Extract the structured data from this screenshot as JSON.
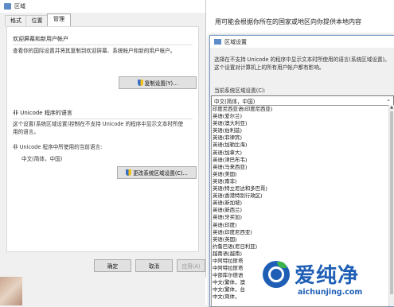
{
  "region_window": {
    "title": "区域",
    "tabs": [
      {
        "label": "格式"
      },
      {
        "label": "位置"
      },
      {
        "label": "管理"
      }
    ],
    "welcome_group": {
      "heading": "欢迎屏幕和新用户帐户",
      "description": "查看你的国际设置并将其复制到欢迎屏幕、系统帐户和新的用户帐户。",
      "button": "复制设置(Y)..."
    },
    "unicode_group": {
      "heading": "非 Unicode 程序的语言",
      "description": "这个设置(系统区域设置)控制在不支持 Unicode 的程序中显示文本时所使用的语言。",
      "current_label": "非 Unicode 程序中所使用的当前语言:",
      "current_value": "中文(简体，中国)",
      "button": "更改系统区域设置(C)..."
    },
    "footer": {
      "ok": "确定",
      "cancel": "取消",
      "apply": "应用(A)"
    }
  },
  "background_page": {
    "text": "用可能会根据你所在的国家或地区向你提供本地内容"
  },
  "region_settings": {
    "title": "区域设置",
    "description": "选择在不支持 Unicode 的程序中显示文本时所使用的语言(系统区域设置)。这个设置对计算机上的所有用户帐户都有影响。",
    "current_label": "当前系统区域设置(C):",
    "selected": "中文(简体，中国)",
    "options": [
      "印度尼西亚语(印度尼西亚)",
      "英语(爱尔兰)",
      "英语(澳大利亚)",
      "英语(伯利兹)",
      "英语(菲律宾)",
      "英语(加勒比海)",
      "英语(加拿大)",
      "英语(津巴布韦)",
      "英语(马来西亚)",
      "英语(美国)",
      "英语(南非)",
      "英语(特立尼达和多巴哥)",
      "英语(香港特别行政区)",
      "英语(新加坡)",
      "英语(新西兰)",
      "英语(牙买加)",
      "英语(印度)",
      "英语(印度尼西亚)",
      "英语(英国)",
      "约鲁巴语(尼日利亚)",
      "越南语(越南)",
      "中阿特拉斯塔",
      "中阿特拉斯塔",
      "中部库尔德语",
      "中文(繁体，澳",
      "中文(繁体，台",
      "中文(简体，"
    ]
  },
  "watermark": {
    "text": "爱纯净",
    "url": "aichunjing.com"
  }
}
